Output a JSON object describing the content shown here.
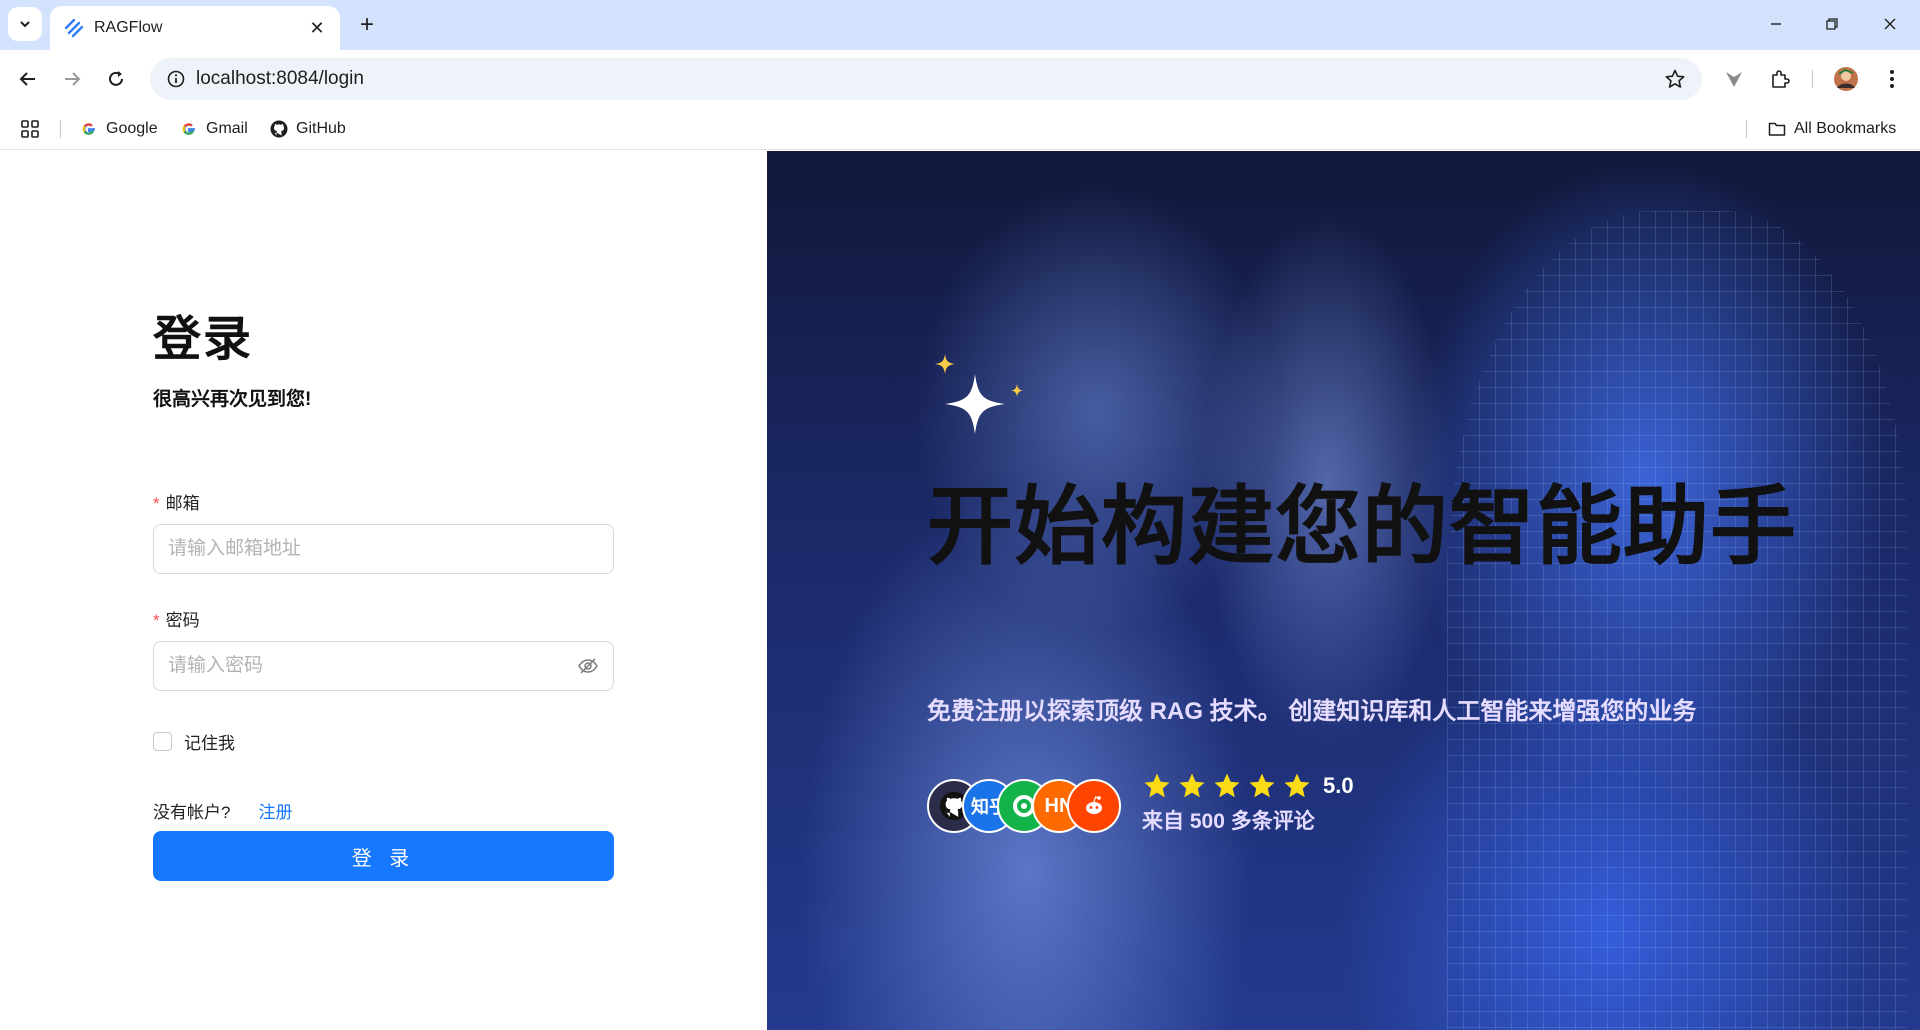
{
  "browser": {
    "tab": {
      "title": "RAGFlow",
      "close": "✕"
    },
    "new_tab": "+",
    "url": "localhost:8084/login",
    "bookmarks": [
      {
        "label": "Google",
        "icon": "google-icon"
      },
      {
        "label": "Gmail",
        "icon": "google-icon"
      },
      {
        "label": "GitHub",
        "icon": "github-icon"
      }
    ],
    "all_bookmarks": "All Bookmarks"
  },
  "login": {
    "title": "登录",
    "subtitle": "很高兴再次见到您!",
    "email": {
      "label": "邮箱",
      "required_mark": "*",
      "placeholder": "请输入邮箱地址"
    },
    "password": {
      "label": "密码",
      "required_mark": "*",
      "placeholder": "请输入密码"
    },
    "remember": "记住我",
    "no_account": "没有帐户?",
    "signup": "注册",
    "submit": "登 录"
  },
  "hero": {
    "title": "开始构建您的智能助手",
    "subtitle": "免费注册以探索顶级 RAG 技术。 创建知识库和人工智能来增强您的业务",
    "rating": "5.0",
    "stars": 5,
    "reviews": "来自 500 多条评论",
    "avatars": [
      {
        "icon": "github-icon",
        "color": "#2b2b4a"
      },
      {
        "label": "知乎",
        "color": "#1a73e8"
      },
      {
        "icon": "wechat-icon",
        "color": "#13b34a"
      },
      {
        "label": "HN",
        "color": "#ff6a00"
      },
      {
        "icon": "reddit-icon",
        "color": "#ff4500"
      }
    ]
  },
  "colors": {
    "primary": "#1677ff",
    "required": "#ff4d4f",
    "tabbar": "#d3e3fd"
  }
}
